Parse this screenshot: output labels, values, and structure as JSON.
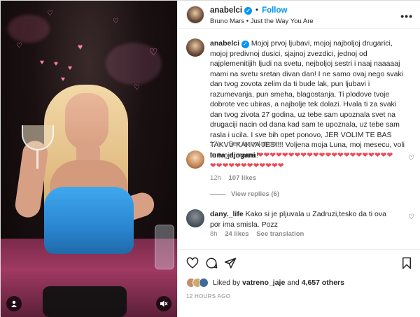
{
  "post": {
    "author": "anabelci",
    "follow_label": "Follow",
    "audio": "Bruno Mars • Just the Way You Are",
    "more_label": "•••"
  },
  "caption": {
    "author": "anabelci",
    "text": "Mojoj prvoj ljubavi, mojoj najboljoj drugarici, mojoj predivnoj dusici, sjajnoj zvezdici, jednoj od najplemenitijih ljudi na svetu, nejboljoj sestri i naaj naaaaaj mami na svetu sretan divan dan! I ne samo ovaj nego svaki dan tvog zovota zelim da ti bude lak, pun ljubavi i razumevanja, pun smeha, blagostanja. Ti plodove tvoje dobrote vec ubiras, a najbolje tek dolazi. Hvala ti za svaki dan tvog zivota 27 godina, uz tebe sam upoznala svet na drugaciji nacin od dana kad sam te upoznala, uz tebe sam rasla i ucila. I sve bih opet ponovo, JER VOLIM TE BAS TAKVU KAKVA JESI!!! Voljena moja Luna, moj mesecu, voli te tvoja mama!",
    "age": "12h",
    "translation": "See translation"
  },
  "comments": [
    {
      "author": "luna_djogani",
      "text": "❤❤❤❤❤❤❤❤❤❤❤❤❤❤❤❤❤❤❤❤❤❤❤❤❤❤❤❤❤❤❤❤❤❤",
      "age": "12h",
      "likes": "107 likes",
      "replies": "View replies (6)"
    },
    {
      "author": "dany._life",
      "text": "Kako si je pljuvala u Zadruzi,tesko da ti ova por ima smisla. Pozz",
      "age": "8h",
      "likes": "24 likes",
      "translation": "See translation"
    }
  ],
  "likes": {
    "prefix": "Liked by",
    "user": "vatreno_jaje",
    "and": "and",
    "others": "4,657 others"
  },
  "timestamp": "12 HOURS AGO",
  "colors": {
    "accent": "#0095f6",
    "text": "#262626",
    "muted": "#8e8e8e",
    "heart": "#ed4956"
  }
}
